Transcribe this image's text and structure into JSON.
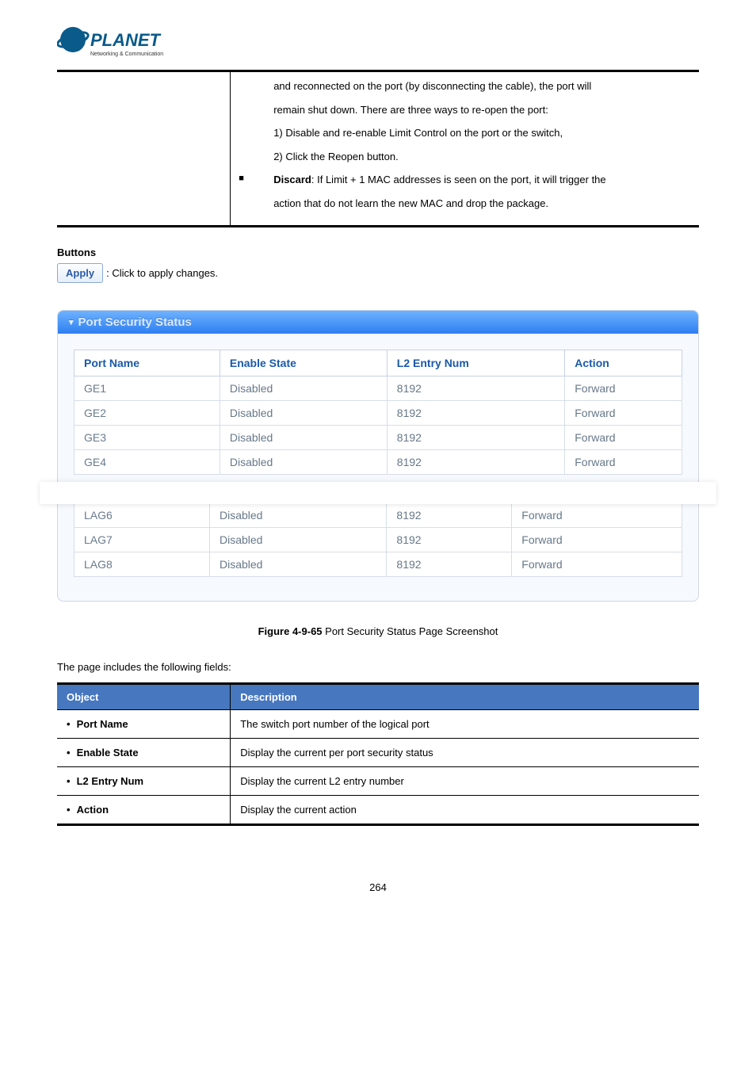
{
  "logo": {
    "brand": "PLANET",
    "tagline": "Networking & Communication"
  },
  "desc": {
    "line1": "and reconnected on the port (by disconnecting the cable), the port will",
    "line2": "remain shut down. There are three ways to re-open the port:",
    "line3": "1) Disable and re-enable Limit Control on the port or the switch,",
    "line4": "2) Click the Reopen button.",
    "bullet_strong": "Discard",
    "bullet_rest": ": If Limit + 1 MAC addresses is seen on the port, it will trigger the",
    "bullet_cont": "action that do not learn the new MAC and drop the package."
  },
  "buttons": {
    "heading": "Buttons",
    "apply_label": "Apply",
    "apply_text": ": Click to apply changes."
  },
  "status_panel": {
    "title": "Port Security Status",
    "headers": {
      "c1": "Port Name",
      "c2": "Enable State",
      "c3": "L2 Entry Num",
      "c4": "Action"
    },
    "rows_top": [
      {
        "c1": "GE1",
        "c2": "Disabled",
        "c3": "8192",
        "c4": "Forward"
      },
      {
        "c1": "GE2",
        "c2": "Disabled",
        "c3": "8192",
        "c4": "Forward"
      },
      {
        "c1": "GE3",
        "c2": "Disabled",
        "c3": "8192",
        "c4": "Forward"
      },
      {
        "c1": "GE4",
        "c2": "Disabled",
        "c3": "8192",
        "c4": "Forward"
      }
    ],
    "rows_bottom": [
      {
        "c1": "LAG6",
        "c2": "Disabled",
        "c3": "8192",
        "c4": "Forward"
      },
      {
        "c1": "LAG7",
        "c2": "Disabled",
        "c3": "8192",
        "c4": "Forward"
      },
      {
        "c1": "LAG8",
        "c2": "Disabled",
        "c3": "8192",
        "c4": "Forward"
      }
    ]
  },
  "figure": {
    "bold": "Figure 4-9-65",
    "rest": " Port Security Status Page Screenshot"
  },
  "fields_intro": "The page includes the following fields:",
  "obj_table": {
    "h1": "Object",
    "h2": "Description",
    "rows": [
      {
        "o": "Port Name",
        "d": "The switch port number of the logical port"
      },
      {
        "o": "Enable State",
        "d": "Display the current per port security status"
      },
      {
        "o": "L2 Entry Num",
        "d": "Display the current L2 entry number"
      },
      {
        "o": "Action",
        "d": "Display the current action"
      }
    ]
  },
  "page_number": "264",
  "chart_data": {
    "type": "table",
    "title": "Port Security Status",
    "columns": [
      "Port Name",
      "Enable State",
      "L2 Entry Num",
      "Action"
    ],
    "rows": [
      [
        "GE1",
        "Disabled",
        8192,
        "Forward"
      ],
      [
        "GE2",
        "Disabled",
        8192,
        "Forward"
      ],
      [
        "GE3",
        "Disabled",
        8192,
        "Forward"
      ],
      [
        "GE4",
        "Disabled",
        8192,
        "Forward"
      ],
      [
        "LAG6",
        "Disabled",
        8192,
        "Forward"
      ],
      [
        "LAG7",
        "Disabled",
        8192,
        "Forward"
      ],
      [
        "LAG8",
        "Disabled",
        8192,
        "Forward"
      ]
    ]
  }
}
